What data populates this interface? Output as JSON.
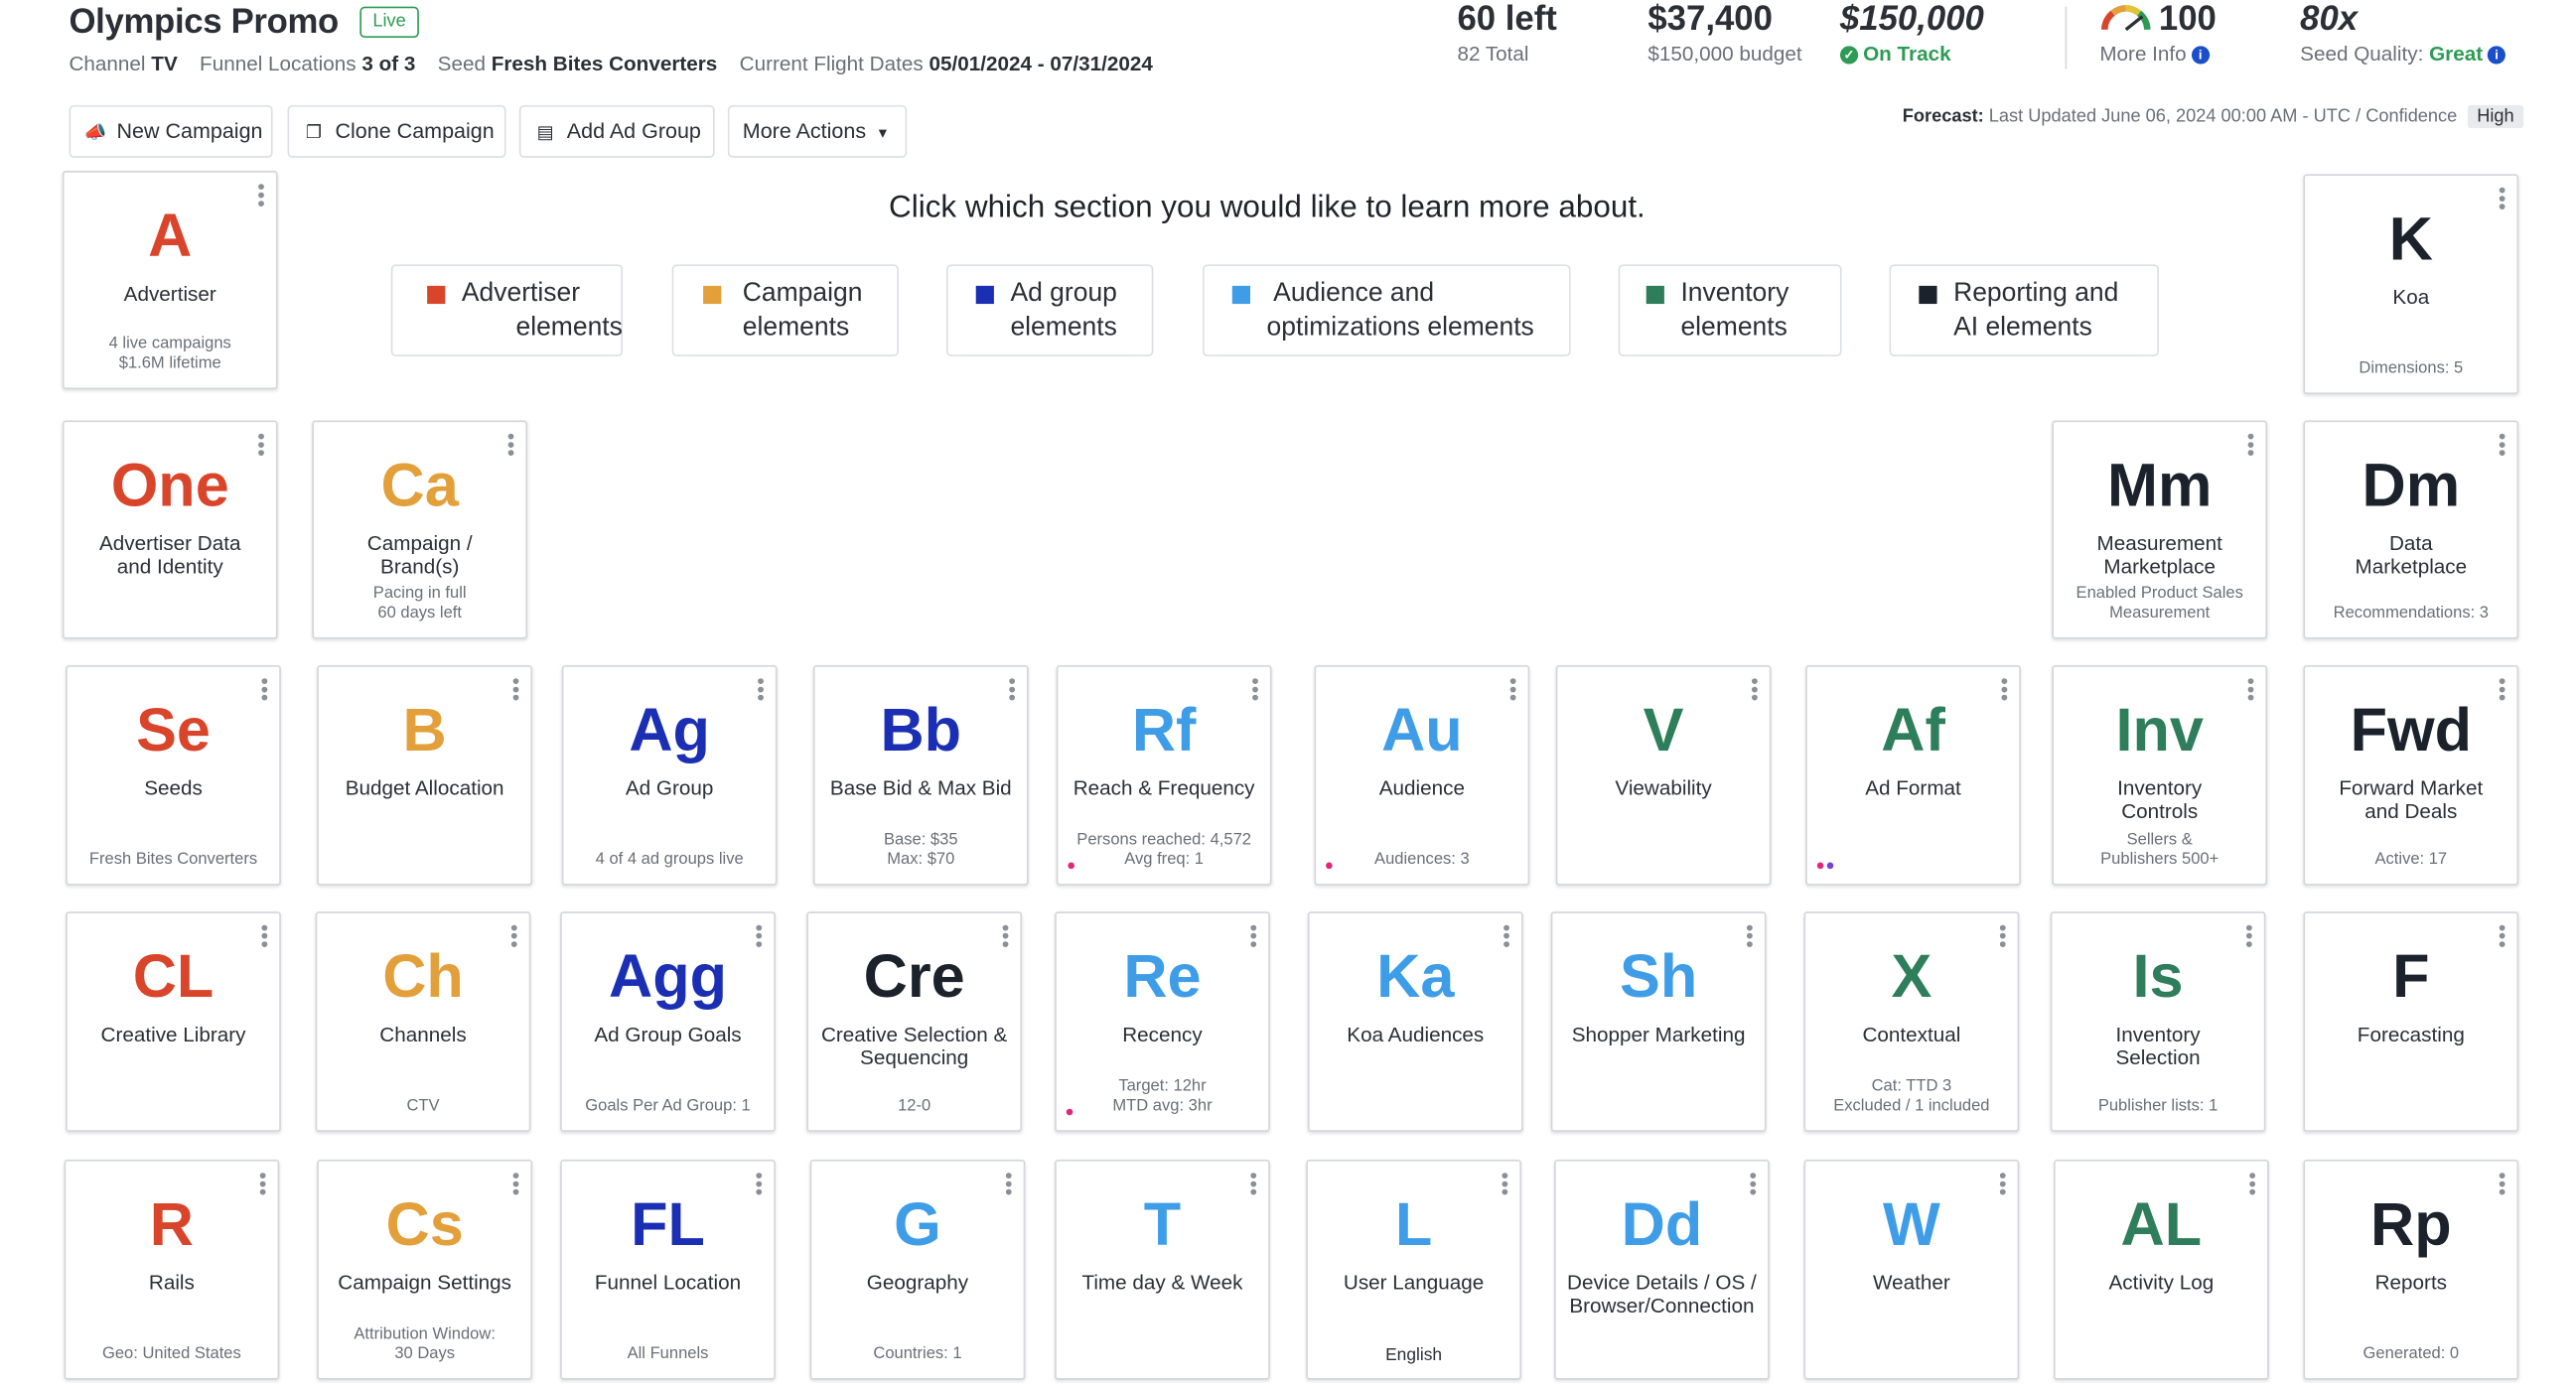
{
  "header": {
    "title": "Olympics Promo",
    "status_badge": "Live",
    "channel_label": "Channel",
    "channel_value": "TV",
    "funnel_label": "Funnel Locations",
    "funnel_value": "3 of 3",
    "seed_label": "Seed",
    "seed_value": "Fresh Bites Converters",
    "flight_label": "Current Flight Dates",
    "flight_value": "05/01/2024 - 07/31/2024"
  },
  "stats": {
    "left": {
      "value": "60 left",
      "sub": "82 Total"
    },
    "spend": {
      "value": "$37,400",
      "sub": "$150,000 budget"
    },
    "budget": {
      "value": "$150,000",
      "status": "On Track"
    },
    "score": {
      "value": "100",
      "sub": "More Info",
      "gauge_fraction": 1.0
    },
    "quality": {
      "value": "80x",
      "sub_label": "Seed Quality:",
      "sub_value": "Great"
    }
  },
  "toolbar": {
    "new_campaign": "New Campaign",
    "clone_campaign": "Clone Campaign",
    "add_ad_group": "Add Ad Group",
    "more_actions": "More Actions"
  },
  "forecast": {
    "label": "Forecast:",
    "updated": "Last Updated June 06, 2024 00:00 AM - UTC",
    "sep": "/",
    "confidence_label": "Confidence",
    "confidence_value": "High"
  },
  "prompt": "Click which section you would like to learn more about.",
  "legend": [
    {
      "line1": "Advertiser",
      "line2": "elements",
      "color": "#d9452b"
    },
    {
      "line1": "Campaign",
      "line2": "elements",
      "color": "#e3a03a"
    },
    {
      "line1": "Ad group",
      "line2": "elements",
      "color": "#1a2fb3"
    },
    {
      "line1": "Audience and",
      "line2": "optimizations elements",
      "color": "#3f9de8"
    },
    {
      "line1": "Inventory",
      "line2": "elements",
      "color": "#2e7d5b"
    },
    {
      "line1": "Reporting and",
      "line2": "AI elements",
      "color": "#1c222b"
    }
  ],
  "colors": {
    "advertiser": "#d9452b",
    "campaign": "#e3a03a",
    "adgroup": "#1a2fb3",
    "audience": "#3f9de8",
    "inventory": "#2e7d5b",
    "reporting": "#1c222b",
    "live_green": "#2e9b55"
  },
  "tiles": [
    {
      "sym": "A",
      "name": "Advertiser",
      "info": "4 live campaigns\n$1.6M lifetime"
    },
    {
      "sym": "K",
      "name": "Koa",
      "info": "Dimensions: 5"
    },
    {
      "sym": "One",
      "name": "Advertiser Data\nand Identity",
      "info": ""
    },
    {
      "sym": "Ca",
      "name": "Campaign /\nBrand(s)",
      "info": "Pacing in full\n60 days left"
    },
    {
      "sym": "Mm",
      "name": "Measurement\nMarketplace",
      "info": "Enabled Product Sales\nMeasurement"
    },
    {
      "sym": "Dm",
      "name": "Data\nMarketplace",
      "info": "Recommendations: 3"
    },
    {
      "sym": "Se",
      "name": "Seeds",
      "info": "Fresh Bites Converters"
    },
    {
      "sym": "B",
      "name": "Budget Allocation",
      "info": ""
    },
    {
      "sym": "Ag",
      "name": "Ad Group",
      "info": "4 of 4 ad groups live"
    },
    {
      "sym": "Bb",
      "name": "Base Bid & Max Bid",
      "info": "Base: $35\nMax: $70"
    },
    {
      "sym": "Rf",
      "name": "Reach & Frequency",
      "info": "Persons reached: 4,572\nAvg freq: 1"
    },
    {
      "sym": "Au",
      "name": "Audience",
      "info": "Audiences: 3"
    },
    {
      "sym": "V",
      "name": "Viewability",
      "info": ""
    },
    {
      "sym": "Af",
      "name": "Ad Format",
      "info": ""
    },
    {
      "sym": "Inv",
      "name": "Inventory\nControls",
      "info": "Sellers &\nPublishers 500+"
    },
    {
      "sym": "Fwd",
      "name": "Forward Market\nand Deals",
      "info": "Active: 17"
    },
    {
      "sym": "CL",
      "name": "Creative Library",
      "info": ""
    },
    {
      "sym": "Ch",
      "name": "Channels",
      "info": "CTV"
    },
    {
      "sym": "Agg",
      "name": "Ad Group Goals",
      "info": "Goals Per Ad Group: 1"
    },
    {
      "sym": "Cre",
      "name": "Creative Selection &\nSequencing",
      "info": "12-0"
    },
    {
      "sym": "Re",
      "name": "Recency",
      "info": "Target: 12hr\nMTD avg: 3hr"
    },
    {
      "sym": "Ka",
      "name": "Koa Audiences",
      "info": ""
    },
    {
      "sym": "Sh",
      "name": "Shopper Marketing",
      "info": ""
    },
    {
      "sym": "X",
      "name": "Contextual",
      "info": "Cat: TTD 3\nExcluded / 1 included"
    },
    {
      "sym": "Is",
      "name": "Inventory\nSelection",
      "info": "Publisher lists: 1"
    },
    {
      "sym": "F",
      "name": "Forecasting",
      "info": ""
    },
    {
      "sym": "R",
      "name": "Rails",
      "info": "Geo: United States"
    },
    {
      "sym": "Cs",
      "name": "Campaign Settings",
      "info": "Attribution Window:\n30 Days"
    },
    {
      "sym": "FL",
      "name": "Funnel Location",
      "info": "All Funnels"
    },
    {
      "sym": "G",
      "name": "Geography",
      "info": "Countries: 1"
    },
    {
      "sym": "T",
      "name": "Time day & Week",
      "info": ""
    },
    {
      "sym": "L",
      "name": "User Language",
      "info": "English"
    },
    {
      "sym": "Dd",
      "name": "Device Details / OS /\nBrowser/Connection",
      "info": ""
    },
    {
      "sym": "W",
      "name": "Weather",
      "info": ""
    },
    {
      "sym": "AL",
      "name": "Activity Log",
      "info": ""
    },
    {
      "sym": "Rp",
      "name": "Reports",
      "info": "Generated: 0"
    }
  ]
}
